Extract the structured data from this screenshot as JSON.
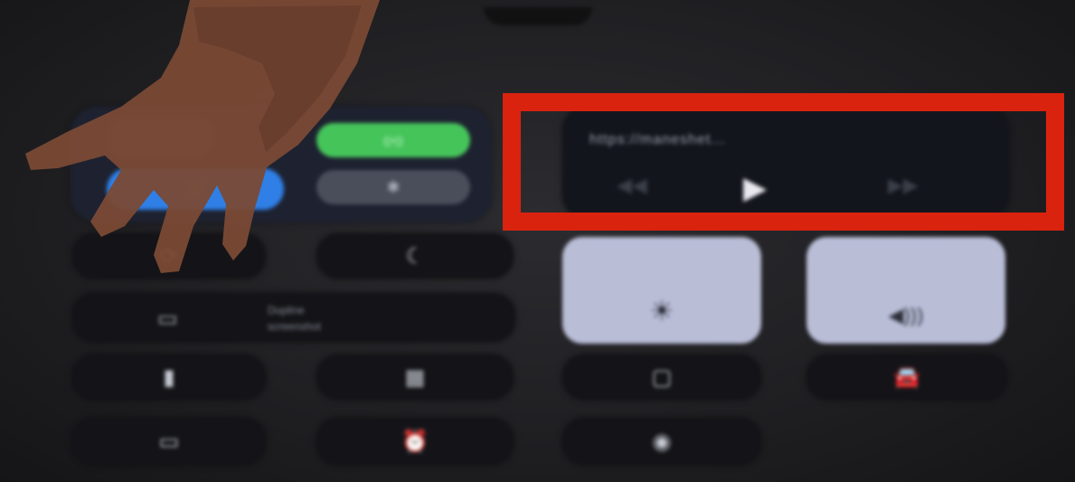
{
  "colors": {
    "highlight_border": "#d9230f",
    "cellular_active": "#45c45a",
    "wifi_active": "#2f7fe6",
    "slider_fill": "#b9bdd6",
    "background": "#1e1e21"
  },
  "connectivity": {
    "airplane_icon": "airplane-icon",
    "cellular_icon": "cellular-icon",
    "wifi_icon": "wifi-icon",
    "bluetooth_icon": "bluetooth-icon",
    "cellular_glyph": "((•))",
    "wifi_glyph": "⌔",
    "bluetooth_glyph": "✱"
  },
  "media": {
    "title": "https://maneshet...",
    "rewind_glyph": "◀◀",
    "play_glyph": "▶",
    "forward_glyph": "▶▶"
  },
  "toggles": {
    "rotation_lock_glyph": "⟳",
    "do_not_disturb_glyph": "☾"
  },
  "sliders": {
    "brightness_glyph": "☀",
    "volume_glyph": "◀)))"
  },
  "screen_mirroring": {
    "icon_glyph": "▭",
    "label": "Dupline\nscreenshot"
  },
  "shortcuts": {
    "flashlight_glyph": "▮",
    "calculator_glyph": "▦",
    "camera_glyph": "▢",
    "car_glyph": "🚘",
    "battery_glyph": "▭",
    "alarm_glyph": "⏰",
    "record_glyph": "◉"
  }
}
